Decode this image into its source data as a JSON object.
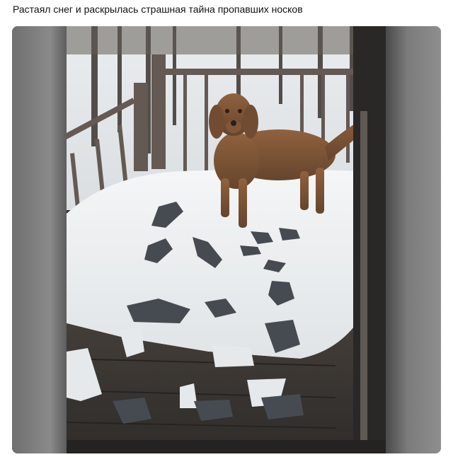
{
  "post": {
    "text": "Растаял снег и раскрылась страшная тайна пропавших носков"
  },
  "media": {
    "image_subject": "dog-on-snowy-porch-with-socks"
  }
}
